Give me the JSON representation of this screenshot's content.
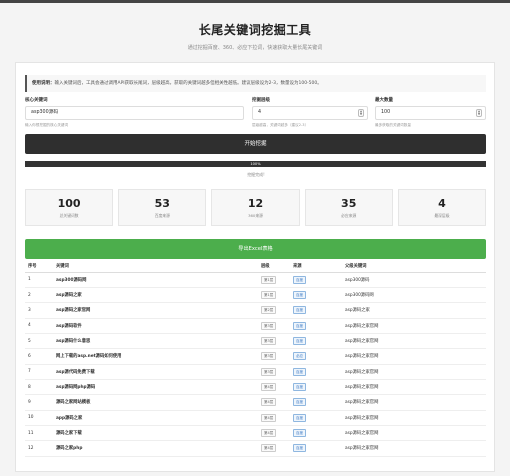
{
  "header": {
    "title": "长尾关键词挖掘工具",
    "subtitle": "通过挖掘百度、360、必应下拉词，快速获取大量长尾关键词"
  },
  "tip": {
    "label": "使用说明：",
    "text": "输入关键词后，工具会通过调用API获取长尾词，层级越高，获取的关键词越多但相关性越低。建议层级设为2-3，数量设为100-500。"
  },
  "form": {
    "keyword": {
      "label": "核心关键词",
      "value": "asp300源码",
      "hint": "输入你想挖掘的核心关键词"
    },
    "depth": {
      "label": "挖掘层级",
      "value": "4",
      "hint": "层级越高，关键词越多（建议2-3）"
    },
    "max": {
      "label": "最大数量",
      "value": "100",
      "hint": "最多获取的关键词数量"
    }
  },
  "start_button": "开始挖掘",
  "progress": {
    "value": 100,
    "label": "100%"
  },
  "status": "挖掘完成!",
  "stats": [
    {
      "num": "100",
      "label": "总关键词数"
    },
    {
      "num": "53",
      "label": "百度来源"
    },
    {
      "num": "12",
      "label": "360来源"
    },
    {
      "num": "35",
      "label": "必应来源"
    },
    {
      "num": "4",
      "label": "最深层级"
    }
  ],
  "export_button": "导出Excel表格",
  "table": {
    "headers": [
      "序号",
      "关键词",
      "层级",
      "来源",
      "父级关键词"
    ],
    "rows": [
      {
        "no": "1",
        "kw": "asp300源码网",
        "lv": "第1层",
        "src": "百度",
        "parent": "asp300源码"
      },
      {
        "no": "2",
        "kw": "asp源码之家",
        "lv": "第1层",
        "src": "百度",
        "parent": "asp300源码网"
      },
      {
        "no": "3",
        "kw": "asp源码之家官网",
        "lv": "第2层",
        "src": "百度",
        "parent": "asp源码之家"
      },
      {
        "no": "4",
        "kw": "asp源码软件",
        "lv": "第3层",
        "src": "百度",
        "parent": "asp源码之家官网"
      },
      {
        "no": "5",
        "kw": "asp源码什么意思",
        "lv": "第3层",
        "src": "百度",
        "parent": "asp源码之家官网"
      },
      {
        "no": "6",
        "kw": "网上下载的asp.net源码如何使用",
        "lv": "第3层",
        "src": "必应",
        "parent": "asp源码之家官网"
      },
      {
        "no": "7",
        "kw": "asp源代码免费下载",
        "lv": "第3层",
        "src": "百度",
        "parent": "asp源码之家官网"
      },
      {
        "no": "8",
        "kw": "asp源码网php源码",
        "lv": "第4层",
        "src": "百度",
        "parent": "asp源码之家官网"
      },
      {
        "no": "9",
        "kw": "源码之家网站模板",
        "lv": "第4层",
        "src": "百度",
        "parent": "asp源码之家官网"
      },
      {
        "no": "10",
        "kw": "app源码之家",
        "lv": "第4层",
        "src": "百度",
        "parent": "asp源码之家官网"
      },
      {
        "no": "11",
        "kw": "源码之家下载",
        "lv": "第4层",
        "src": "百度",
        "parent": "asp源码之家官网"
      },
      {
        "no": "12",
        "kw": "源码之家php",
        "lv": "第4层",
        "src": "百度",
        "parent": "asp源码之家官网"
      }
    ]
  },
  "colors": {
    "primary": "#2f2f2f",
    "export": "#4cae4c"
  }
}
